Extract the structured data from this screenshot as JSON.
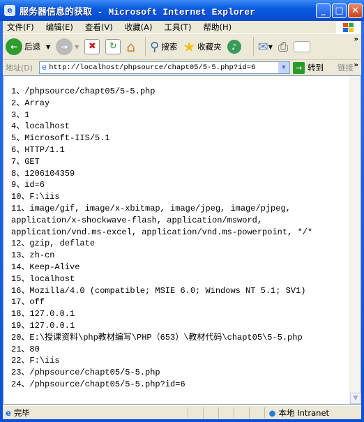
{
  "window": {
    "title": "服务器信息的获取 - Microsoft Internet Explorer"
  },
  "menu": [
    "文件(F)",
    "编辑(E)",
    "查看(V)",
    "收藏(A)",
    "工具(T)",
    "帮助(H)"
  ],
  "toolbar": {
    "back": "后退",
    "search": "搜索",
    "favorites": "收藏夹",
    "more": "»"
  },
  "address": {
    "label": "地址(D)",
    "url": "http://localhost/phpsource/chapt05/5-5.php?id=6",
    "go": "转到",
    "links": "链接"
  },
  "content": {
    "lines": [
      "1、/phpsource/chapt05/5-5.php",
      "2、Array",
      "3、1",
      "4、localhost",
      "5、Microsoft-IIS/5.1",
      "6、HTTP/1.1",
      "7、GET",
      "8、1206104359",
      "9、id=6",
      "10、F:\\iis",
      "11、image/gif, image/x-xbitmap, image/jpeg, image/pjpeg,\napplication/x-shockwave-flash, application/msword,\napplication/vnd.ms-excel, application/vnd.ms-powerpoint, */*",
      "12、gzip, deflate",
      "13、zh-cn",
      "14、Keep-Alive",
      "15、localhost",
      "16、Mozilla/4.0 (compatible; MSIE 6.0; Windows NT 5.1; SV1)",
      "17、off",
      "18、127.0.0.1",
      "19、127.0.0.1",
      "20、E:\\授课资料\\php教材编写\\PHP（653）\\教材代码\\chapt05\\5-5.php",
      "21、80",
      "22、F:\\iis",
      "23、/phpsource/chapt05/5-5.php",
      "24、/phpsource/chapt05/5-5.php?id=6"
    ]
  },
  "status": {
    "text": "完毕",
    "zone": "本地 Intranet"
  }
}
